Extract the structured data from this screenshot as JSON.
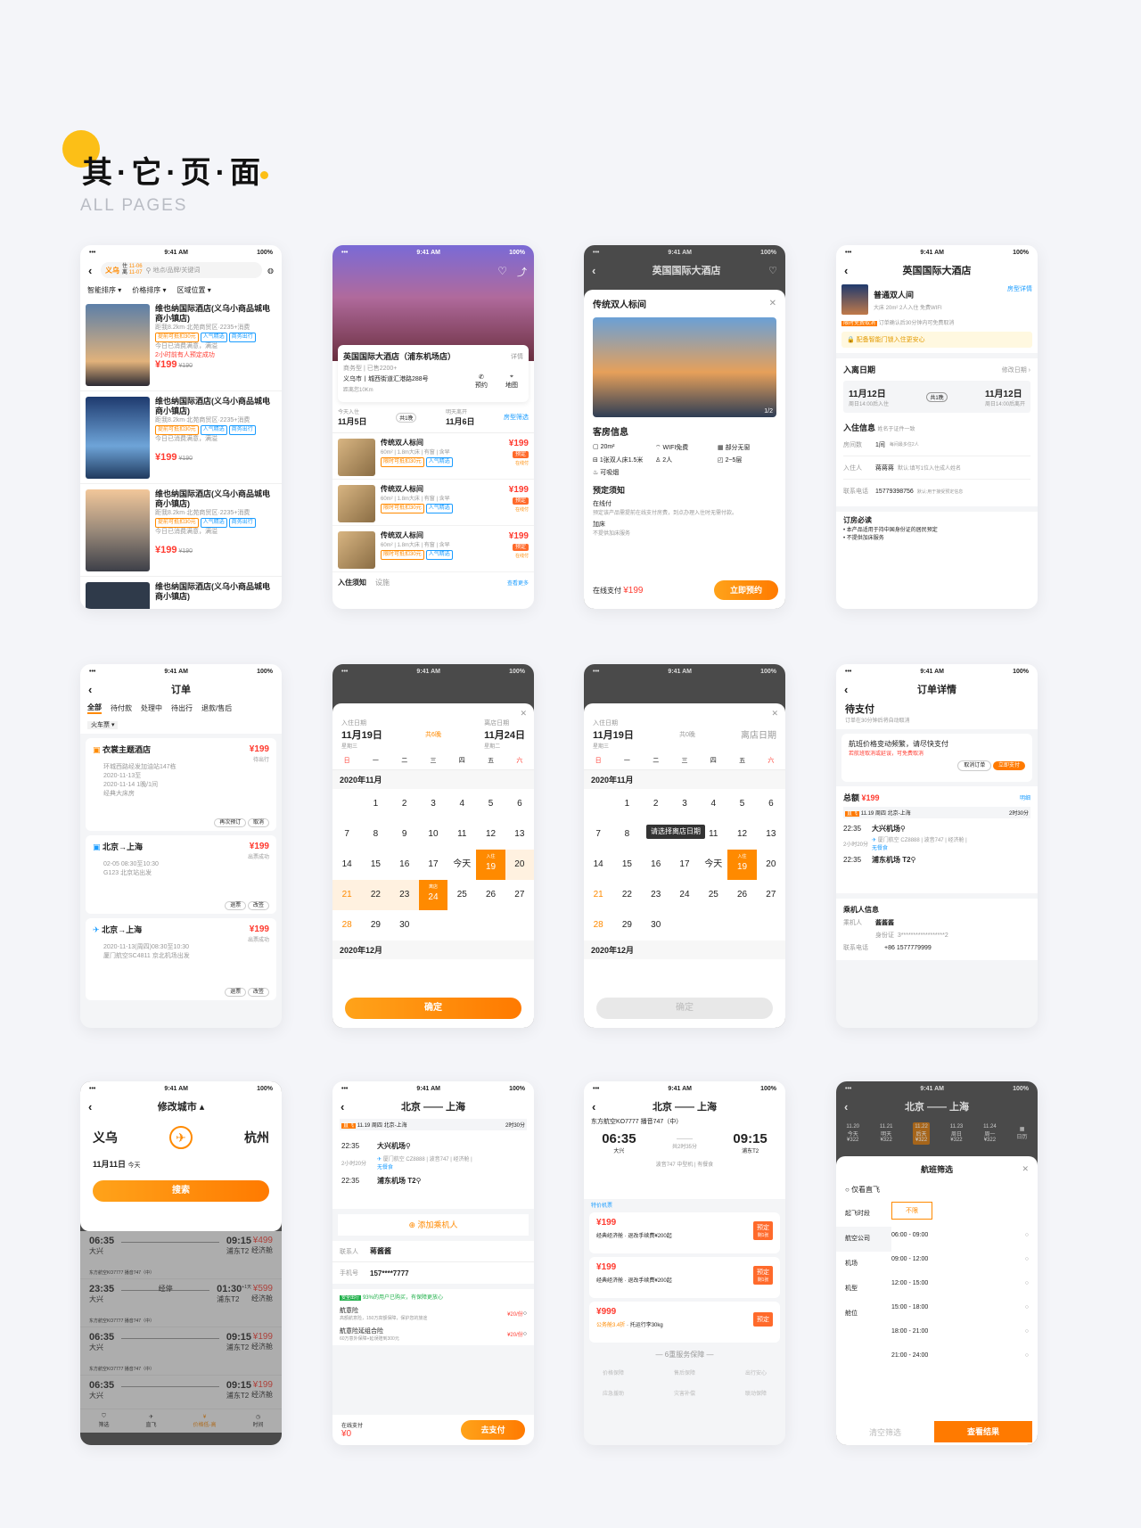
{
  "header": {
    "title": "其·它·页·面",
    "subtitle": "ALL PAGES"
  },
  "status": {
    "time": "9:41 AM",
    "battery": "100%"
  },
  "p1": {
    "city": "义乌",
    "in_label": "住",
    "in_date": "11-06",
    "out_label": "离",
    "out_date": "11-07",
    "search_ph": "地点/品牌/关键词",
    "sort": "智能排序",
    "price_sort": "价格排序",
    "area": "区域位置",
    "hotels": [
      {
        "name": "维也纳国际酒店(义乌小商品城电商小镇店)",
        "dist": "距我8.2km·北苑商贸区·2235+消费",
        "t1": "提前可抵扣30元",
        "t2": "人气精选",
        "t3": "商务出行",
        "note": "今日已消费满意，满溢",
        "note2": "2小时前有人预定成功",
        "price": "199",
        "old": "¥190"
      },
      {
        "name": "维也纳国际酒店(义乌小商品城电商小镇店)",
        "dist": "距我8.2km·北苑商贸区·2235+消费",
        "t1": "提前可抵扣30元",
        "t2": "人气精选",
        "t3": "商务出行",
        "note": "今日已消费满意，满溢",
        "note2": "",
        "price": "199",
        "old": "¥190"
      },
      {
        "name": "维也纳国际酒店(义乌小商品城电商小镇店)",
        "dist": "距我8.2km·北苑商贸区·2235+消费",
        "t1": "提前可抵扣30元",
        "t2": "人气精选",
        "t3": "商务出行",
        "note": "今日已消费满意，满溢",
        "note2": "",
        "price": "199",
        "old": "¥190"
      },
      {
        "name": "维也纳国际酒店(义乌小商品城电商小镇店)",
        "dist": "",
        "t1": "",
        "t2": "",
        "t3": "",
        "note": "",
        "note2": "",
        "price": "",
        "old": ""
      }
    ]
  },
  "p2": {
    "name": "英国国际大酒店（浦东机场店）",
    "detail": "详情",
    "type": "商务型 | 已售2200+",
    "addr": "义乌市丨城西街道汇港路288号",
    "dist": "距离您10Km",
    "phone": "预约",
    "map": "地图",
    "in_lbl": "今天入住",
    "out_lbl": "明天离开",
    "in_date": "11月5日",
    "nights": "共1晚",
    "out_date": "11月6日",
    "filter": "房型筛选",
    "rooms": [
      {
        "name": "传统双人标间",
        "spec": "60m² | 1.8m大床 | 有窗 | 含早",
        "t1": "限时可抵扣30元",
        "t2": "人气精选",
        "price": "199",
        "book": "预定",
        "rest": "在线付",
        "cnt": "3张"
      },
      {
        "name": "传统双人标间",
        "spec": "60m² | 1.8m大床 | 有窗 | 含早",
        "t1": "限时可抵扣30元",
        "t2": "人气精选",
        "price": "199",
        "book": "预定",
        "rest": "在线付",
        "cnt": "3张"
      },
      {
        "name": "传统双人标间",
        "spec": "60m² | 1.8m大床 | 有窗 | 含早",
        "t1": "限时可抵扣30元",
        "t2": "人气精选",
        "price": "199",
        "book": "预定",
        "rest": "在线付",
        "cnt": "3张"
      }
    ],
    "notice": "入住须知",
    "facility": "设施",
    "more": "查看更多"
  },
  "p3": {
    "title": "英国国际大酒店",
    "room": "传统双人标间",
    "counter": "1/2",
    "info": "客房信息",
    "f1": "20m²",
    "f2": "WIFI免费",
    "f3": "部分无窗",
    "f4": "1张双人床1.5米",
    "f5": "2人",
    "f6": "2~5层",
    "f7": "可吸烟",
    "policy": "预定须知",
    "pay_title": "在线付",
    "pay_desc": "预定该产品需提前在线支付房费，到点办理入住时无需付款。",
    "bed_title": "加床",
    "bed_desc": "不提供加床服务",
    "pay_label": "在线支付",
    "price": "¥199",
    "cta": "立即预约"
  },
  "p4": {
    "title": "英国国际大酒店",
    "room": "普通双人间",
    "room_detail": "房型详情",
    "spec": "大床  20m²  2人入住  免费WIFI",
    "cancel_tag": "限时免费取消",
    "cancel_desc": "订单确认后30分钟内可免费取消",
    "tip": "配备智能门锁入住更安心",
    "leave": "入离日期",
    "modify": "修改日期",
    "d1": "11月12日",
    "d1s": "周日14:00后入住",
    "nights": "共1晚",
    "d2": "11月12日",
    "d2s": "周日14:00后离开",
    "guest_info": "入住信息",
    "guest_hint": "姓名于证件一致",
    "rooms_lbl": "房间数",
    "rooms_val": "1间",
    "rooms_hint": "每间最多住2人",
    "guest_lbl": "入住人",
    "guest_val": "蒋蒋蒋",
    "guest_hint2": "默认:填写1位入住成人姓名",
    "phone_lbl": "联系电话",
    "phone_val": "15779398756",
    "phone_hint": "默认:用于接受预定信息",
    "must": "订房必读",
    "m1": "• 本产品适用于持中国身份证的居民预定",
    "m2": "• 不提供加床服务"
  },
  "p5": {
    "title": "订单",
    "tabs": [
      "全部",
      "待付款",
      "处理中",
      "待出行",
      "退款/售后"
    ],
    "filter": "火车票",
    "orders": [
      {
        "name": "衣裳主题酒店",
        "price": "199",
        "status": "待出行",
        "l1": "环城西路经发加油站147栋",
        "l2": "2020-11-13至",
        "l3": "2020-11-14 1晚/1间",
        "l4": "经典大床房",
        "b1": "再次预订",
        "b2": "取消"
      },
      {
        "name": "北京→上海",
        "price": "199",
        "status": "出票成功",
        "l1": "02-05  08:30至10:30",
        "l2": "G123 北京站出发",
        "l3": "",
        "l4": "",
        "b1": "退票",
        "b2": "改签"
      },
      {
        "name": "北京→上海",
        "price": "199",
        "status": "出票成功",
        "l1": "2020-11-13(周四)08:30至10:30",
        "l2": "厦门航空SC4811 京北机场出发",
        "l3": "",
        "l4": "",
        "b1": "退票",
        "b2": "改签"
      }
    ]
  },
  "cal": {
    "in_lbl": "入住日期",
    "in_date": "11月19日",
    "in_week": "星期三",
    "nights": "共6晚",
    "out_lbl": "离店日期",
    "out_date": "11月24日",
    "out_week": "星期二",
    "nights2": "共0晚",
    "out_ph": "离店日期",
    "weekdays": [
      "日",
      "一",
      "二",
      "三",
      "四",
      "五",
      "六"
    ],
    "month1": "2020年11月",
    "month2": "2020年12月",
    "today": "今天",
    "in_tag": "入住",
    "out_tag": "离店",
    "confirm": "确定",
    "tooltip": "请选择离店日期"
  },
  "p8": {
    "title": "订单详情",
    "status": "待支付",
    "deadline": "订单在30分钟后将自动取消",
    "warn": "航班价格变动频繁，请尽快支付",
    "warn2": "若航班取消或延误，可免费取消",
    "cancel": "取消订单",
    "pay": "立即支付",
    "total_lbl": "总额",
    "total": "199",
    "detail": "明细",
    "type": "直飞",
    "date": "11.19 周四 北京-上海",
    "dur": "2时30分",
    "t1": "22:35",
    "a1": "大兴机场",
    "mid": "2小时20分",
    "flight": "厦门航空 CZ8888 | 波音747 | 经济舱 |",
    "meal": "无餐食",
    "t2": "22:35",
    "a2": "浦东机场 T2",
    "pass_title": "乘机人信息",
    "pass_lbl": "乘机人",
    "pass_name": "酱酱酱",
    "id_lbl": "身份证",
    "id": "3******************2",
    "phone_lbl": "联系电话",
    "phone": "+86 1577779999"
  },
  "p9": {
    "title": "修改城市",
    "from": "义乌",
    "to": "杭州",
    "date": "11月11日",
    "today": "今天",
    "search": "搜索",
    "flights": [
      {
        "dep": "06:35",
        "arr": "09:15",
        "da": "大兴",
        "aa": "浦东T2",
        "price": "499",
        "cls": "经济舱",
        "air": "东方航空KO7777 播音747（中）",
        "stop": "",
        "plus": ""
      },
      {
        "dep": "23:35",
        "arr": "01:30",
        "da": "大兴",
        "aa": "浦东T2",
        "price": "599",
        "cls": "经济舱",
        "air": "东方航空KO7777 播音747（中）",
        "stop": "经停",
        "plus": "+1天"
      },
      {
        "dep": "06:35",
        "arr": "09:15",
        "da": "大兴",
        "aa": "浦东T2",
        "price": "199",
        "cls": "经济舱",
        "air": "东方航空KO7777 播音747（中）",
        "stop": "",
        "plus": ""
      },
      {
        "dep": "06:35",
        "arr": "09:15",
        "da": "大兴",
        "aa": "浦东T2",
        "price": "199",
        "cls": "经济舱",
        "air": "",
        "stop": "",
        "plus": ""
      }
    ],
    "bottom": [
      "筛选",
      "价格低-高",
      "时间"
    ],
    "bottom2": [
      "直飞",
      "",
      "时间早-晚"
    ]
  },
  "p10": {
    "title": "北京 —— 上海",
    "type": "直飞",
    "date": "11.19 周四 北京-上海",
    "dur": "2时30分",
    "t1": "22:35",
    "a1": "大兴机场",
    "mid": "2小时20分",
    "flight": "厦门航空 CZ8888 | 波音747 | 经济舱 |",
    "meal": "无餐食",
    "t2": "22:35",
    "a2": "浦东机场 T2",
    "add": "添加乘机人",
    "contact_lbl": "联系人",
    "contact": "蒋酱酱",
    "phone_lbl": "手机号",
    "phone": "157****7777",
    "safe_tag": "安全出行",
    "safe": "93%的用户已购买，有保障更放心",
    "ins1": "航意险",
    "ins1d": "高额航意险，150万高额保障，保护您的旅途",
    "ins1p": "¥20/份",
    "ins2": "航意险延组合险",
    "ins2d": "60万意外保障+延误赔到300元",
    "ins2p": "¥20/份",
    "pay_lbl": "在线支付",
    "pay": "¥0",
    "cta": "去支付"
  },
  "p11": {
    "title": "北京 —— 上海",
    "air": "东方航空KO7777 播音747（中）",
    "dep": "06:35",
    "arr": "09:15",
    "da": "大兴",
    "aa": "浦东T2",
    "dur": "共2时35分",
    "plane": "波音747 中型机 | 有餐食",
    "tag": "特价机票",
    "fares": [
      {
        "price": "199",
        "desc": "经典经济舱",
        "sub": "退改手续费¥200起",
        "btn": "预定",
        "rest": "剩1张"
      },
      {
        "price": "199",
        "desc": "经典经济舱",
        "sub": "退改手续费¥200起",
        "btn": "预定",
        "rest": "剩1张"
      },
      {
        "price": "999",
        "desc": "公务舱3.4折",
        "sub": "托运行李30kg",
        "btn": "预定",
        "rest": ""
      }
    ],
    "guarantee": "— 6重服务保障 —",
    "g": [
      "价格保障",
      "售后保障",
      "出行安心",
      "应急援助",
      "灾害补偿",
      "联动保障"
    ]
  },
  "p12": {
    "title": "北京 —— 上海",
    "dates": [
      {
        "d": "11.20",
        "w": "今天",
        "p": "¥322"
      },
      {
        "d": "11.21",
        "w": "明天",
        "p": "¥322"
      },
      {
        "d": "11.22",
        "w": "后天",
        "p": "¥322"
      },
      {
        "d": "11.23",
        "w": "周日",
        "p": "¥322"
      },
      {
        "d": "11.24",
        "w": "周一",
        "p": "¥322"
      }
    ],
    "cal": "日历",
    "sheet": "航班筛选",
    "direct": "仅看直飞",
    "cats": [
      "起飞时段",
      "航空公司",
      "机场",
      "机型",
      "舱位"
    ],
    "nolimit": "不限",
    "times": [
      "06:00 - 09:00",
      "09:00 - 12:00",
      "12:00 - 15:00",
      "15:00 - 18:00",
      "18:00 - 21:00",
      "21:00 - 24:00"
    ],
    "clear": "清空筛选",
    "result": "查看结果"
  },
  "colors": {
    "accent": "#ff8a00",
    "price": "#ff3b30",
    "brand_yellow": "#fcbf17"
  }
}
